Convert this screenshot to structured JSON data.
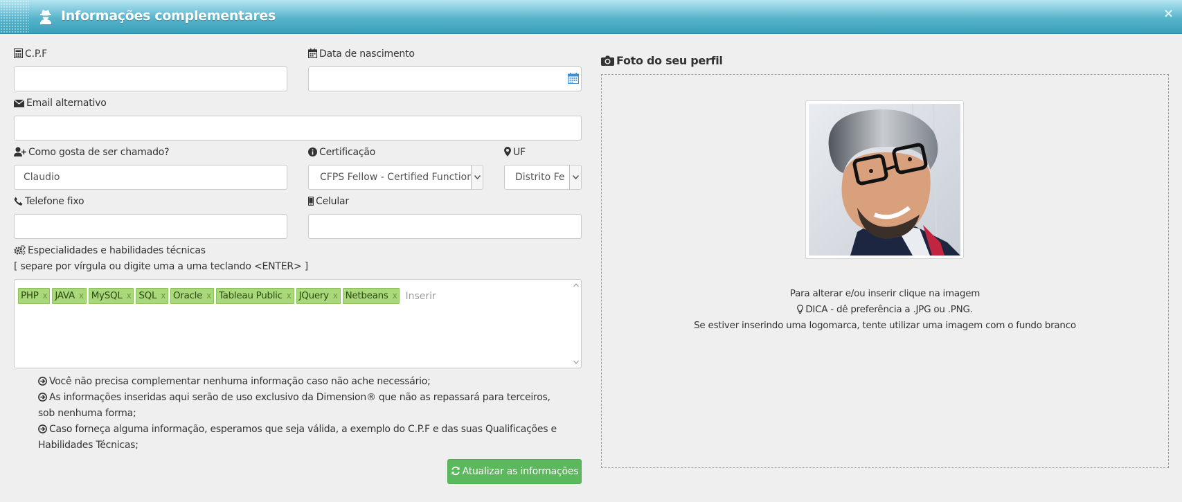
{
  "header": {
    "title": "Informações complementares",
    "icon": "user-secret-icon",
    "close": "×"
  },
  "form": {
    "cpf": {
      "label": "C.P.F",
      "value": ""
    },
    "birth": {
      "label": "Data de nascimento",
      "value": ""
    },
    "alt_email": {
      "label": "Email alternativo",
      "value": ""
    },
    "nickname": {
      "label": "Como gosta de ser chamado?",
      "value": "Claudio"
    },
    "certification": {
      "label": "Certificação",
      "value": "CFPS Fellow - Certified Function P"
    },
    "uf": {
      "label": "UF",
      "value": "Distrito Fe"
    },
    "phone": {
      "label": "Telefone fixo",
      "value": ""
    },
    "mobile": {
      "label": "Celular",
      "value": ""
    },
    "skills": {
      "label": "Especialidades e habilidades técnicas",
      "hint": "[ separe por vírgula ou digite uma a uma teclando <ENTER> ]",
      "tags": [
        "PHP",
        "JAVA",
        "MySQL",
        "SQL",
        "Oracle",
        "Tableau Public",
        "JQuery",
        "Netbeans"
      ],
      "remove_label": "x",
      "placeholder": "Inserir"
    }
  },
  "notes": [
    "Você não precisa complementar nenhuma informação caso não ache necessário;",
    "As informações inseridas aqui serão de uso exclusivo da Dimension® que não as repassará para terceiros, sob nenhuma forma;",
    "Caso forneça alguma informação, esperamos que seja válida, a exemplo do C.P.F e das suas Qualificações e Habilidades Técnicas;"
  ],
  "submit_label": "Atualizar as informações",
  "photo": {
    "title": "Foto do seu perfil",
    "line1": "Para alterar e/ou inserir clique na imagem",
    "line2": "DICA - dê preferência a .JPG ou .PNG.",
    "line3": "Se estiver inserindo uma logomarca, tente utilizar uma imagem com o fundo branco"
  },
  "colors": {
    "header": "#57b4cb",
    "tag_bg": "#a8d879",
    "button": "#5cb85c"
  }
}
